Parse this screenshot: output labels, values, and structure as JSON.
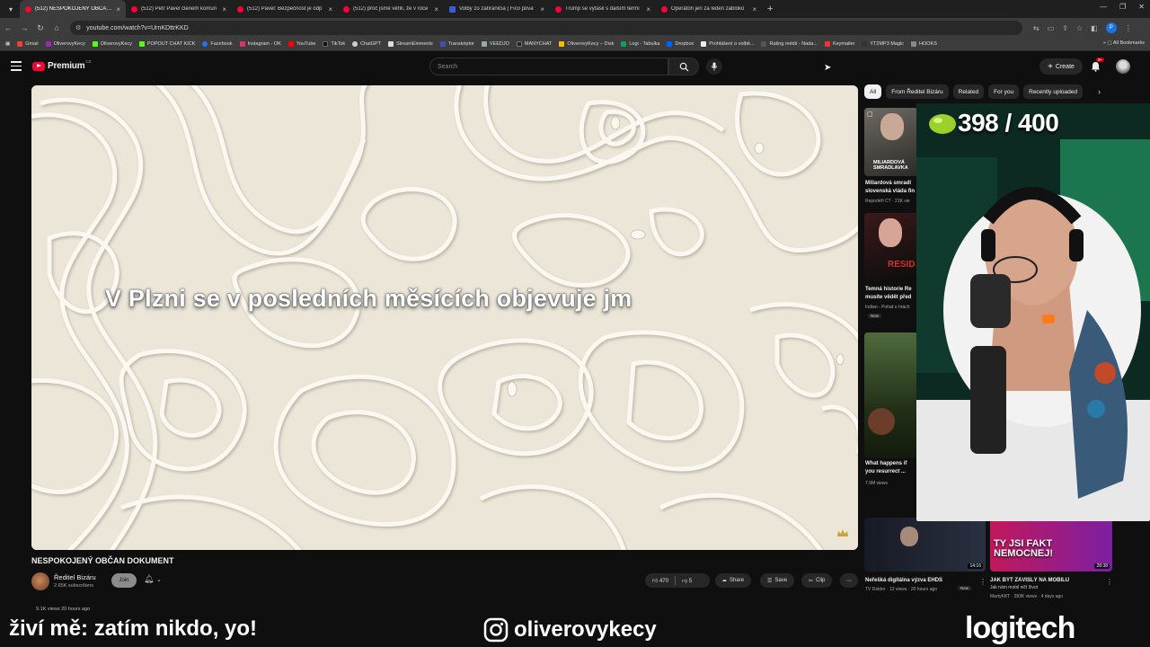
{
  "browser": {
    "tabs": [
      {
        "title": "(512) NESPOKOJENÝ OBČAN DO",
        "active": true,
        "favicon": "youtube"
      },
      {
        "title": "(512) Petr Pavel členem komun",
        "active": false,
        "favicon": "youtube"
      },
      {
        "title": "(512) Pavel: Bezpečnost je odp",
        "active": false,
        "favicon": "youtube"
      },
      {
        "title": "(512) proč jsme věřili, že v roce",
        "active": false,
        "favicon": "youtube"
      },
      {
        "title": "Volby zo zahraničia | Fico pova",
        "active": false,
        "favicon": "p"
      },
      {
        "title": "Trump se vytasil s dalším termí",
        "active": false,
        "favicon": "youtube"
      },
      {
        "title": "Operátoři jen za leden zabloko",
        "active": false,
        "favicon": "youtube"
      }
    ],
    "url": "youtube.com/watch?v=UrnKDttrKKD",
    "profile_letter": "P",
    "bookmarks": [
      "Gmail",
      "OliverovyKecy",
      "OliverovyKecy",
      "POPOUT CHAT KICK",
      "Facebook",
      "Instagram - OK",
      "YouTube",
      "TikTok",
      "ChatGPT",
      "StreamElements",
      "Transkriptor",
      "VEEDJO",
      "MANYCHAT",
      "OliverovyKecy – Disk",
      "Logi - Tabulka",
      "Dropbox",
      "Prohlášení o volbě...",
      "Rating médií - Nada...",
      "Keymailer",
      "YT2MP3 Magic",
      "HOOKS"
    ],
    "all_bookmarks": "All Bookmarks"
  },
  "youtube": {
    "logo_text": "Premium",
    "logo_country": "CZ",
    "search_placeholder": "Search",
    "create_label": "Create",
    "notification_count": "9+"
  },
  "video": {
    "subtitle": "V Plzni se v posledních měsících objevuje jm",
    "title": "NESPOKOJENÝ OBČAN DOKUMENT",
    "channel": "Ředitel Bizáru",
    "subscribers": "2.65K subscribers",
    "join_label": "Join",
    "likes": "470",
    "dislikes": "5",
    "share_label": "Share",
    "save_label": "Save",
    "clip_label": "Clip",
    "views": "9.1K views  20 hours ago"
  },
  "sidebar": {
    "chips": [
      "All",
      "From Ředitel Bizáru",
      "Related",
      "For you",
      "Recently uploaded"
    ],
    "recommendations": [
      {
        "thumb_text": "MILIARDOVÁ SMRADLAVKA",
        "title": "Miliardová smradl",
        "title2": "slovenská vláda fin",
        "meta": "Reportéři ČT · 21K vie"
      },
      {
        "thumb_text": "RESID",
        "title": "Temná historie Re",
        "title2": "musíte vědět před",
        "meta": "Indian - Pořad o hrách",
        "badge": "New"
      },
      {
        "title": "What happens if",
        "title2": "you resurrect ...",
        "meta": "7.9M views"
      },
      {
        "thumb_text": "",
        "title": "Neřešká digitálna výzva EHDS",
        "meta": "TV Doktor · 12 views · 20 hours ago",
        "badge": "New",
        "duration": "14:16"
      },
      {
        "thumb_text": "TY JSI FAKT NEMOCNEJ!",
        "title": "JAK BÝT ZÁVISLÝ NA MOBILU",
        "title2": "Jak nám mobil ničí život",
        "meta": "MartyKKT · 283K views · 4 days ago",
        "duration": "28:38"
      }
    ]
  },
  "webcam": {
    "counter": "398 / 400"
  },
  "overlays": {
    "left_text": "živí mě: zatím nikdo, yo!",
    "instagram_handle": "oliverovykecy",
    "sponsor": "logitech"
  },
  "colors": {
    "youtube_red": "#ff0033",
    "background": "#0f0f0f",
    "chip_bg": "#272727",
    "video_bg": "#ebe6d8"
  }
}
